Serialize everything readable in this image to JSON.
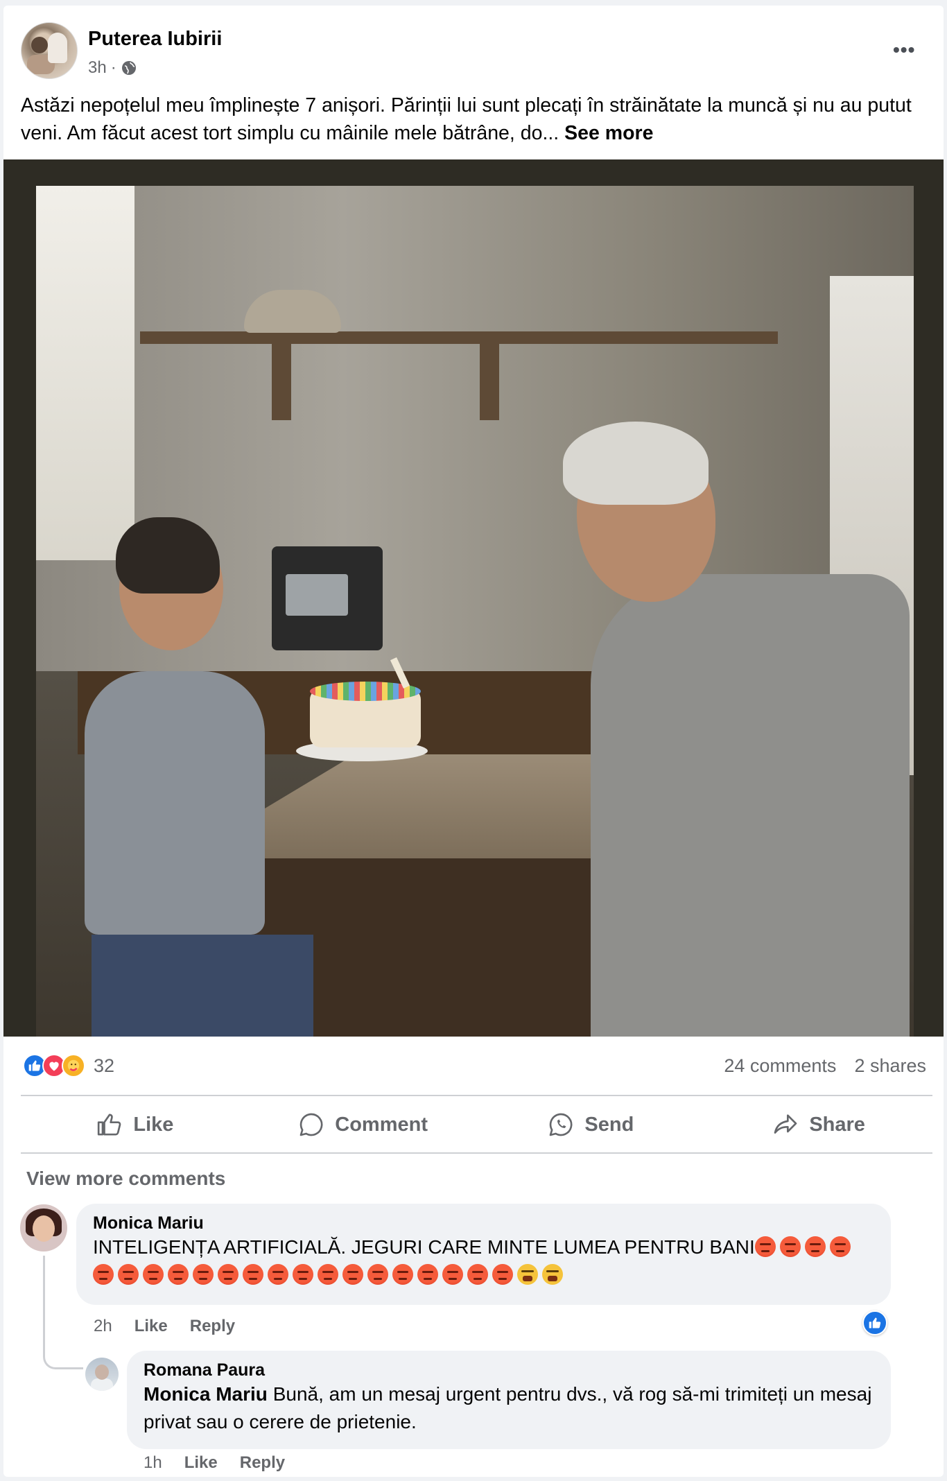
{
  "post": {
    "page_name": "Puterea Iubirii",
    "time": "3h",
    "separator": "·",
    "privacy_icon": "globe-icon",
    "more_icon": "•••",
    "text": "Astăzi nepoțelul meu împlinește 7 anișori. Părinții lui sunt plecați în străinătate la muncă și nu au putut veni. Am făcut acest tort simplu cu mâinile mele bătrâne, do...",
    "see_more": "See more"
  },
  "stats": {
    "reaction_icons": [
      "like-icon",
      "love-icon",
      "care-icon"
    ],
    "reaction_count": "32",
    "comments": "24 comments",
    "shares": "2 shares"
  },
  "actions": {
    "like": "Like",
    "comment": "Comment",
    "send": "Send",
    "share": "Share"
  },
  "comments_section": {
    "view_more": "View more comments",
    "comment1": {
      "author": "Monica Mariu",
      "text": "INTELIGENȚA ARTIFICIALĂ. JEGURI CARE MINTE LUMEA PENTRU BANI",
      "trailing_emojis": "angry-face x4",
      "second_line_emojis": "angry-face x17, tired-face x2",
      "time": "2h",
      "like": "Like",
      "reply": "Reply",
      "reaction_icon": "like-icon"
    },
    "comment2": {
      "author": "Romana Paura",
      "mention": "Monica Mariu",
      "text": " Bună, am un mesaj urgent pentru dvs., vă rog să-mi trimiteți un mesaj privat sau o cerere de prietenie.",
      "time": "1h",
      "like": "Like",
      "reply": "Reply"
    }
  },
  "colors": {
    "accent": "#1b74e4",
    "secondary_text": "#65676b",
    "bubble": "#f0f2f5"
  }
}
